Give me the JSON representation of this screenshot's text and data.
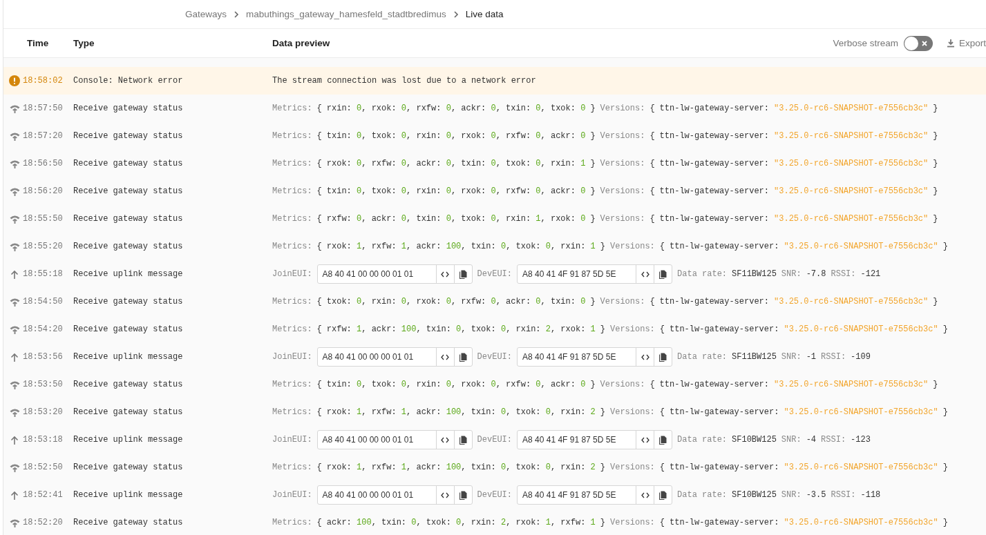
{
  "breadcrumbs": [
    {
      "label": "Gateways",
      "current": false
    },
    {
      "label": "mabuthings_gateway_hamesfeld_stadtbredimus",
      "current": false
    },
    {
      "label": "Live data",
      "current": true
    }
  ],
  "columns": [
    "Time",
    "Type",
    "Data preview"
  ],
  "verbose_stream": {
    "label": "Verbose stream",
    "on": false
  },
  "export": {
    "label": "Export"
  },
  "rows": [
    {
      "kind": "error",
      "time": "18:58:02",
      "type": "Console: Network error",
      "message": "The stream connection was lost due to a network error"
    },
    {
      "kind": "status",
      "time": "18:57:50",
      "type": "Receive gateway status",
      "metrics_label": "Metrics:",
      "open": "{",
      "metrics": [
        [
          "rxin:",
          "0"
        ],
        [
          ", rxok:",
          "0"
        ],
        [
          ", rxfw:",
          "0"
        ],
        [
          ", ackr:",
          "0"
        ],
        [
          ", txin:",
          "0"
        ],
        [
          ", txok:",
          "0"
        ]
      ],
      "close": "}",
      "versions_label": "Versions:",
      "version_key": "ttn-lw-gateway-server:",
      "version_value": "\"3.25.0-rc6-SNAPSHOT-e7556cb3c\""
    },
    {
      "kind": "status",
      "time": "18:57:20",
      "type": "Receive gateway status",
      "metrics_label": "Metrics:",
      "open": "{",
      "metrics": [
        [
          "txin:",
          "0"
        ],
        [
          ", txok:",
          "0"
        ],
        [
          ", rxin:",
          "0"
        ],
        [
          ", rxok:",
          "0"
        ],
        [
          ", rxfw:",
          "0"
        ],
        [
          ", ackr:",
          "0"
        ]
      ],
      "close": "}",
      "versions_label": "Versions:",
      "version_key": "ttn-lw-gateway-server:",
      "version_value": "\"3.25.0-rc6-SNAPSHOT-e7556cb3c\""
    },
    {
      "kind": "status",
      "time": "18:56:50",
      "type": "Receive gateway status",
      "metrics_label": "Metrics:",
      "open": "{",
      "metrics": [
        [
          "rxok:",
          "0"
        ],
        [
          ", rxfw:",
          "0"
        ],
        [
          ", ackr:",
          "0"
        ],
        [
          ", txin:",
          "0"
        ],
        [
          ", txok:",
          "0"
        ],
        [
          ", rxin:",
          "1"
        ]
      ],
      "close": "}",
      "versions_label": "Versions:",
      "version_key": "ttn-lw-gateway-server:",
      "version_value": "\"3.25.0-rc6-SNAPSHOT-e7556cb3c\""
    },
    {
      "kind": "status",
      "time": "18:56:20",
      "type": "Receive gateway status",
      "metrics_label": "Metrics:",
      "open": "{",
      "metrics": [
        [
          "txin:",
          "0"
        ],
        [
          ", txok:",
          "0"
        ],
        [
          ", rxin:",
          "0"
        ],
        [
          ", rxok:",
          "0"
        ],
        [
          ", rxfw:",
          "0"
        ],
        [
          ", ackr:",
          "0"
        ]
      ],
      "close": "}",
      "versions_label": "Versions:",
      "version_key": "ttn-lw-gateway-server:",
      "version_value": "\"3.25.0-rc6-SNAPSHOT-e7556cb3c\""
    },
    {
      "kind": "status",
      "time": "18:55:50",
      "type": "Receive gateway status",
      "metrics_label": "Metrics:",
      "open": "{",
      "metrics": [
        [
          "rxfw:",
          "0"
        ],
        [
          ", ackr:",
          "0"
        ],
        [
          ", txin:",
          "0"
        ],
        [
          ", txok:",
          "0"
        ],
        [
          ", rxin:",
          "1"
        ],
        [
          ", rxok:",
          "0"
        ]
      ],
      "close": "}",
      "versions_label": "Versions:",
      "version_key": "ttn-lw-gateway-server:",
      "version_value": "\"3.25.0-rc6-SNAPSHOT-e7556cb3c\""
    },
    {
      "kind": "status",
      "time": "18:55:20",
      "type": "Receive gateway status",
      "metrics_label": "Metrics:",
      "open": "{",
      "metrics": [
        [
          "rxok:",
          "1"
        ],
        [
          ", rxfw:",
          "1"
        ],
        [
          ", ackr:",
          "100"
        ],
        [
          ", txin:",
          "0"
        ],
        [
          ", txok:",
          "0"
        ],
        [
          ", rxin:",
          "1"
        ]
      ],
      "close": "}",
      "versions_label": "Versions:",
      "version_key": "ttn-lw-gateway-server:",
      "version_value": "\"3.25.0-rc6-SNAPSHOT-e7556cb3c\""
    },
    {
      "kind": "uplink",
      "time": "18:55:18",
      "type": "Receive uplink message",
      "join_label": "JoinEUI:",
      "join_eui": "A8 40 41 00 00 00 01 01",
      "dev_label": "DevEUI:",
      "dev_eui": "A8 40 41 4F 91 87 5D 5E",
      "rate_label": "Data rate:",
      "rate": "SF11BW125",
      "snr_label": "SNR:",
      "snr": "-7.8",
      "rssi_label": "RSSI:",
      "rssi": "-121"
    },
    {
      "kind": "status",
      "time": "18:54:50",
      "type": "Receive gateway status",
      "metrics_label": "Metrics:",
      "open": "{",
      "metrics": [
        [
          "txok:",
          "0"
        ],
        [
          ", rxin:",
          "0"
        ],
        [
          ", rxok:",
          "0"
        ],
        [
          ", rxfw:",
          "0"
        ],
        [
          ", ackr:",
          "0"
        ],
        [
          ", txin:",
          "0"
        ]
      ],
      "close": "}",
      "versions_label": "Versions:",
      "version_key": "ttn-lw-gateway-server:",
      "version_value": "\"3.25.0-rc6-SNAPSHOT-e7556cb3c\""
    },
    {
      "kind": "status",
      "time": "18:54:20",
      "type": "Receive gateway status",
      "metrics_label": "Metrics:",
      "open": "{",
      "metrics": [
        [
          "rxfw:",
          "1"
        ],
        [
          ", ackr:",
          "100"
        ],
        [
          ", txin:",
          "0"
        ],
        [
          ", txok:",
          "0"
        ],
        [
          ", rxin:",
          "2"
        ],
        [
          ", rxok:",
          "1"
        ]
      ],
      "close": "}",
      "versions_label": "Versions:",
      "version_key": "ttn-lw-gateway-server:",
      "version_value": "\"3.25.0-rc6-SNAPSHOT-e7556cb3c\""
    },
    {
      "kind": "uplink",
      "time": "18:53:56",
      "type": "Receive uplink message",
      "join_label": "JoinEUI:",
      "join_eui": "A8 40 41 00 00 00 01 01",
      "dev_label": "DevEUI:",
      "dev_eui": "A8 40 41 4F 91 87 5D 5E",
      "rate_label": "Data rate:",
      "rate": "SF11BW125",
      "snr_label": "SNR:",
      "snr": "-1",
      "rssi_label": "RSSI:",
      "rssi": "-109"
    },
    {
      "kind": "status",
      "time": "18:53:50",
      "type": "Receive gateway status",
      "metrics_label": "Metrics:",
      "open": "{",
      "metrics": [
        [
          "txin:",
          "0"
        ],
        [
          ", txok:",
          "0"
        ],
        [
          ", rxin:",
          "0"
        ],
        [
          ", rxok:",
          "0"
        ],
        [
          ", rxfw:",
          "0"
        ],
        [
          ", ackr:",
          "0"
        ]
      ],
      "close": "}",
      "versions_label": "Versions:",
      "version_key": "ttn-lw-gateway-server:",
      "version_value": "\"3.25.0-rc6-SNAPSHOT-e7556cb3c\""
    },
    {
      "kind": "status",
      "time": "18:53:20",
      "type": "Receive gateway status",
      "metrics_label": "Metrics:",
      "open": "{",
      "metrics": [
        [
          "rxok:",
          "1"
        ],
        [
          ", rxfw:",
          "1"
        ],
        [
          ", ackr:",
          "100"
        ],
        [
          ", txin:",
          "0"
        ],
        [
          ", txok:",
          "0"
        ],
        [
          ", rxin:",
          "2"
        ]
      ],
      "close": "}",
      "versions_label": "Versions:",
      "version_key": "ttn-lw-gateway-server:",
      "version_value": "\"3.25.0-rc6-SNAPSHOT-e7556cb3c\""
    },
    {
      "kind": "uplink",
      "time": "18:53:18",
      "type": "Receive uplink message",
      "join_label": "JoinEUI:",
      "join_eui": "A8 40 41 00 00 00 01 01",
      "dev_label": "DevEUI:",
      "dev_eui": "A8 40 41 4F 91 87 5D 5E",
      "rate_label": "Data rate:",
      "rate": "SF10BW125",
      "snr_label": "SNR:",
      "snr": "-4",
      "rssi_label": "RSSI:",
      "rssi": "-123"
    },
    {
      "kind": "status",
      "time": "18:52:50",
      "type": "Receive gateway status",
      "metrics_label": "Metrics:",
      "open": "{",
      "metrics": [
        [
          "rxok:",
          "1"
        ],
        [
          ", rxfw:",
          "1"
        ],
        [
          ", ackr:",
          "100"
        ],
        [
          ", txin:",
          "0"
        ],
        [
          ", txok:",
          "0"
        ],
        [
          ", rxin:",
          "2"
        ]
      ],
      "close": "}",
      "versions_label": "Versions:",
      "version_key": "ttn-lw-gateway-server:",
      "version_value": "\"3.25.0-rc6-SNAPSHOT-e7556cb3c\""
    },
    {
      "kind": "uplink",
      "time": "18:52:41",
      "type": "Receive uplink message",
      "join_label": "JoinEUI:",
      "join_eui": "A8 40 41 00 00 00 01 01",
      "dev_label": "DevEUI:",
      "dev_eui": "A8 40 41 4F 91 87 5D 5E",
      "rate_label": "Data rate:",
      "rate": "SF10BW125",
      "snr_label": "SNR:",
      "snr": "-3.5",
      "rssi_label": "RSSI:",
      "rssi": "-118"
    },
    {
      "kind": "status",
      "time": "18:52:20",
      "type": "Receive gateway status",
      "metrics_label": "Metrics:",
      "open": "{",
      "metrics": [
        [
          "ackr:",
          "100"
        ],
        [
          ", txin:",
          "0"
        ],
        [
          ", txok:",
          "0"
        ],
        [
          ", rxin:",
          "2"
        ],
        [
          ", rxok:",
          "1"
        ],
        [
          ", rxfw:",
          "1"
        ]
      ],
      "close": "}",
      "versions_label": "Versions:",
      "version_key": "ttn-lw-gateway-server:",
      "version_value": "\"3.25.0-rc6-SNAPSHOT-e7556cb3c\""
    }
  ]
}
